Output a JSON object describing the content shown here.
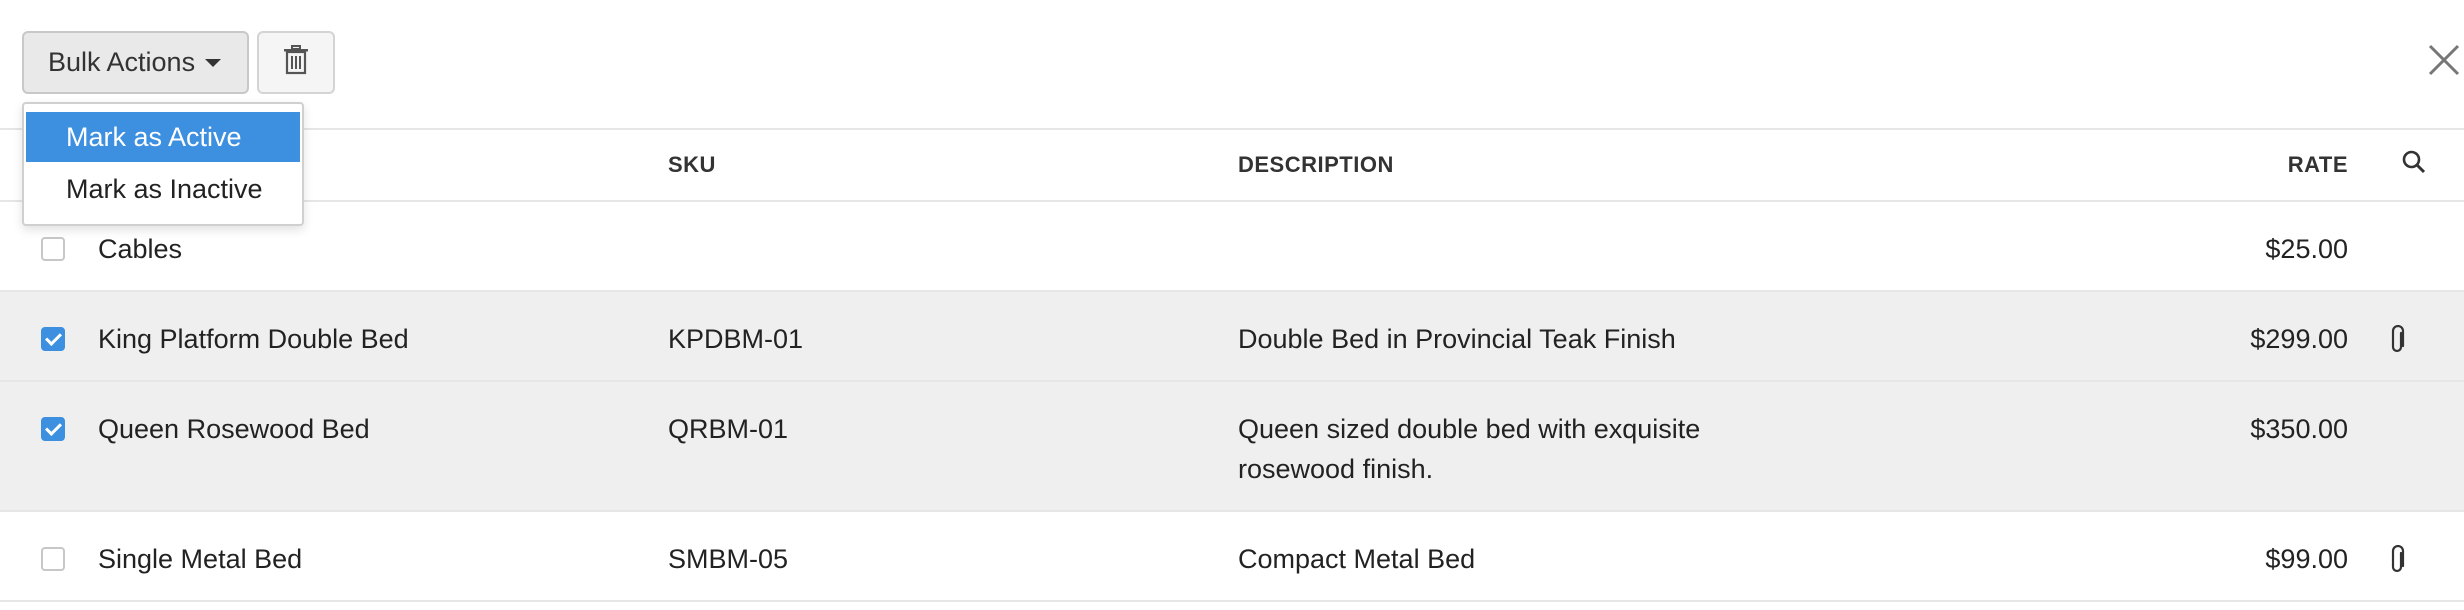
{
  "toolbar": {
    "bulk_actions_label": "Bulk Actions",
    "delete_icon": "trash-icon",
    "close_icon": "close-icon"
  },
  "dropdown": {
    "items": [
      {
        "label": "Mark as Active",
        "active": true
      },
      {
        "label": "Mark as Inactive",
        "active": false
      }
    ]
  },
  "table": {
    "columns": {
      "sku": "SKU",
      "description": "DESCRIPTION",
      "rate": "RATE"
    },
    "search_icon": "search-icon",
    "rows": [
      {
        "checked": false,
        "name": "Cables",
        "sku": "",
        "description": "",
        "rate": "$25.00",
        "attachment": false
      },
      {
        "checked": true,
        "name": "King Platform Double Bed",
        "sku": "KPDBM-01",
        "description": "Double Bed in Provincial Teak Finish",
        "rate": "$299.00",
        "attachment": true
      },
      {
        "checked": true,
        "name": "Queen Rosewood Bed",
        "sku": "QRBM-01",
        "description": "Queen sized double bed with exquisite rosewood finish.",
        "rate": "$350.00",
        "attachment": false
      },
      {
        "checked": false,
        "name": "Single Metal Bed",
        "sku": "SMBM-05",
        "description": "Compact Metal Bed",
        "rate": "$99.00",
        "attachment": true
      }
    ]
  },
  "colors": {
    "accent": "#3d8fe0",
    "selected_row": "#efefef",
    "border": "#e6e6e6"
  }
}
